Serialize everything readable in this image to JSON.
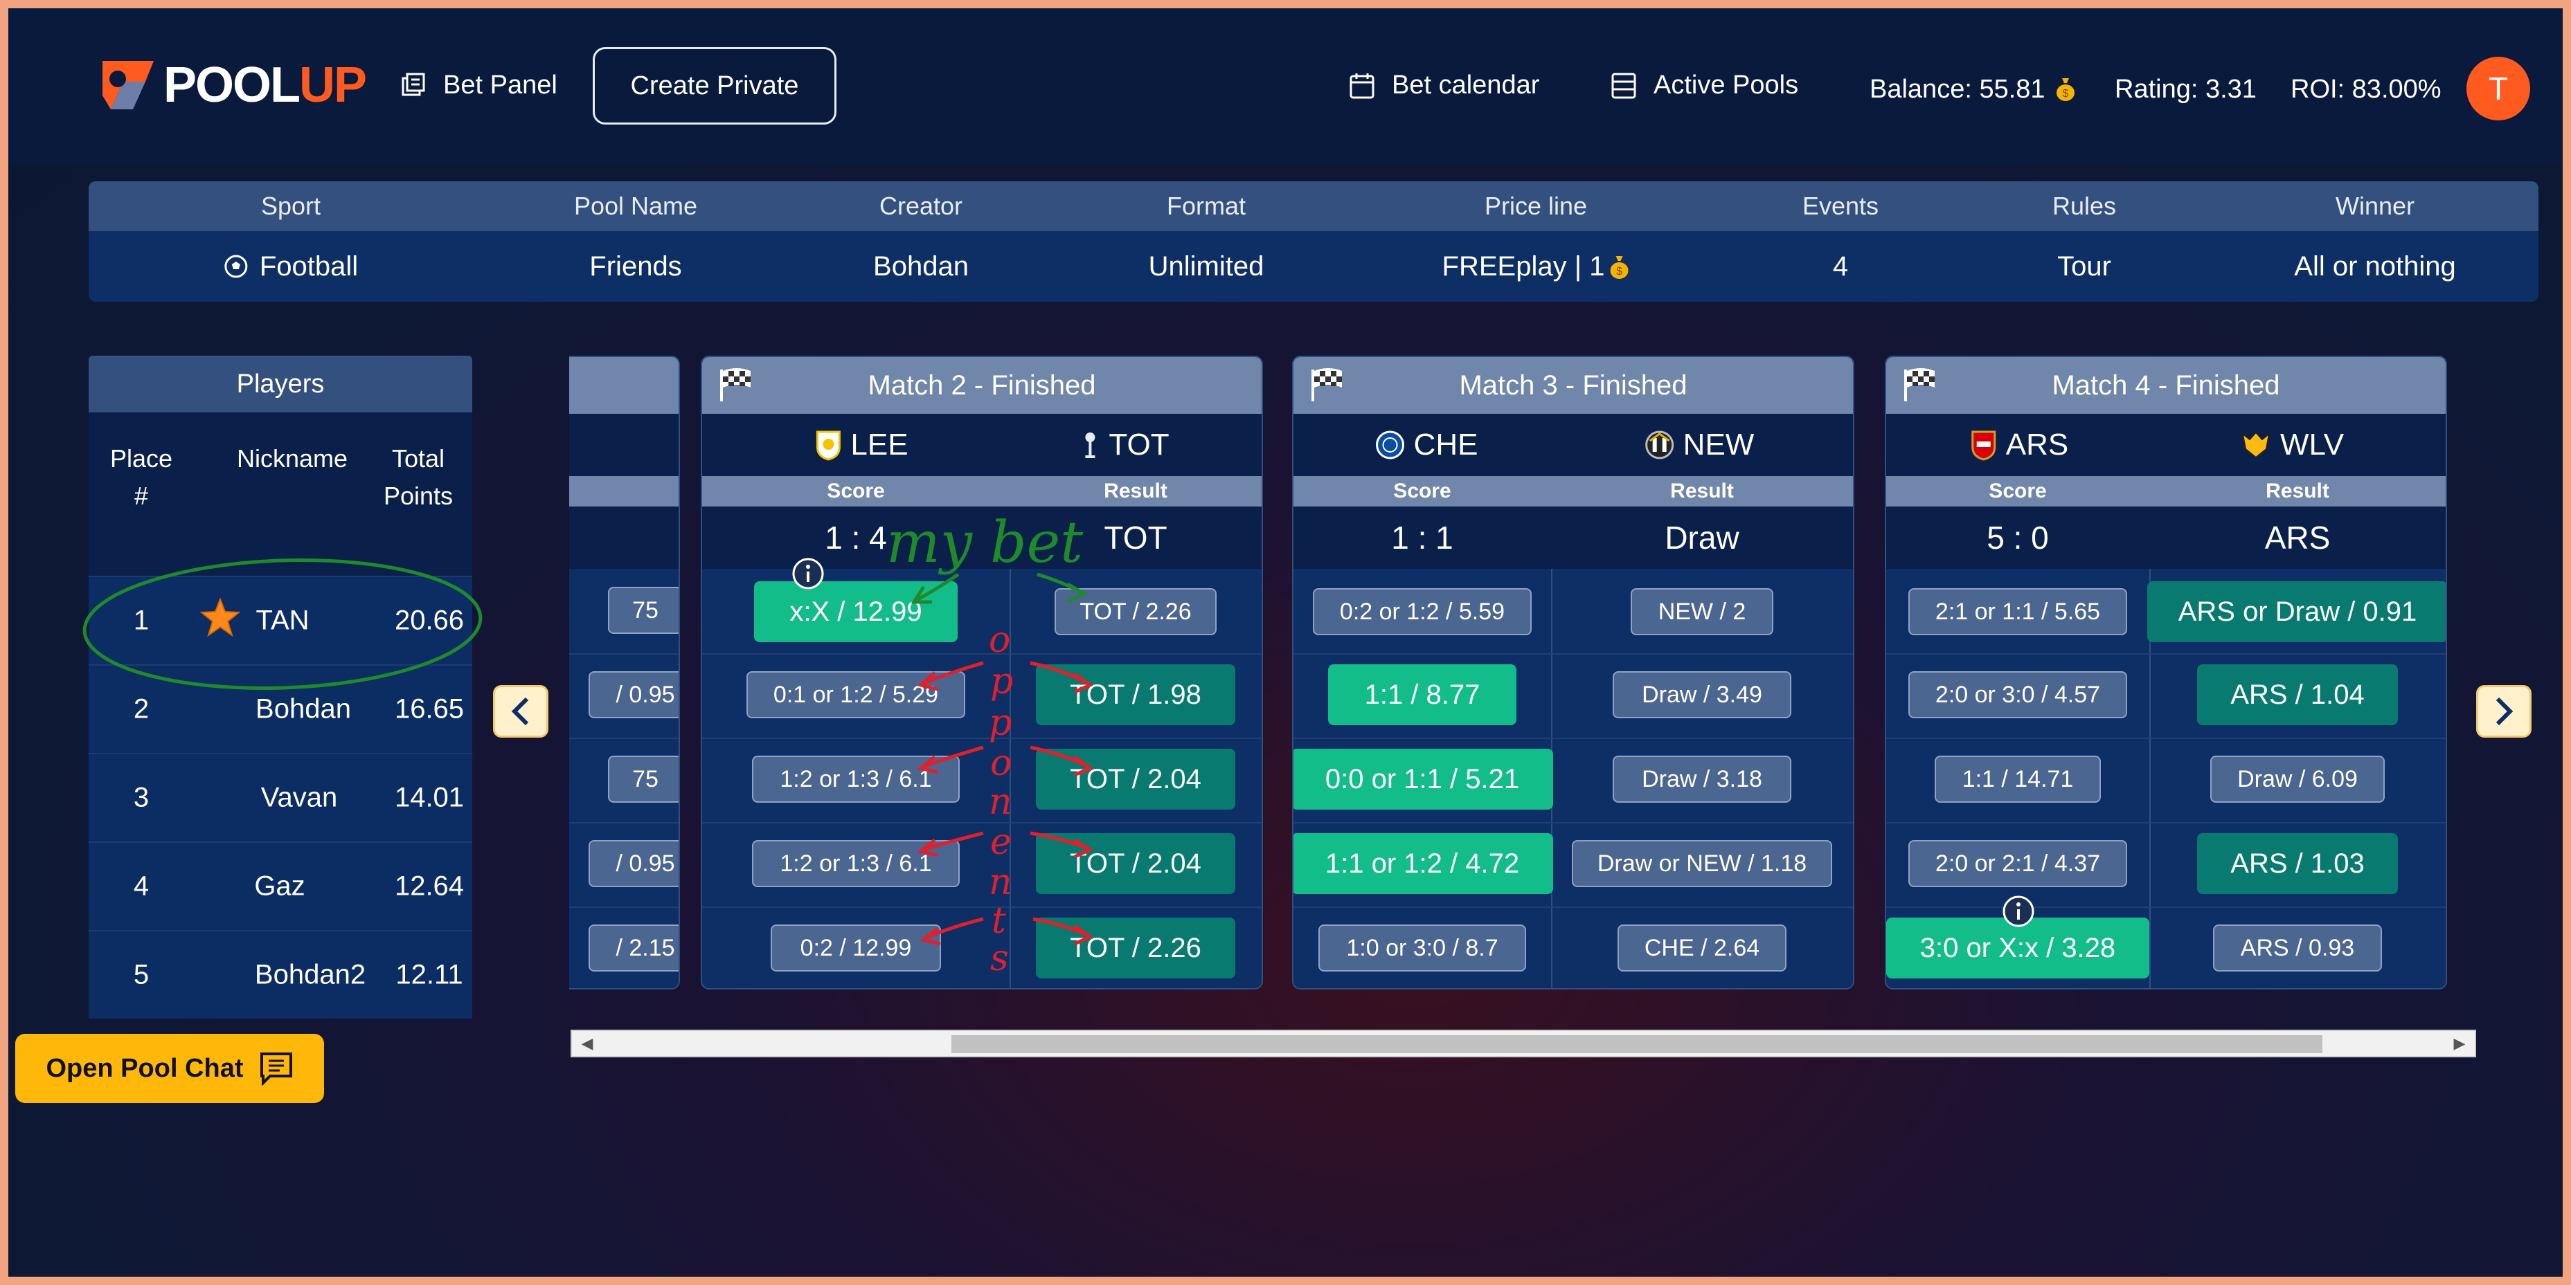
{
  "header": {
    "logo_pool": "POOL",
    "logo_up": "UP",
    "bet_panel": "Bet Panel",
    "create_private": "Create Private",
    "bet_calendar": "Bet calendar",
    "active_pools": "Active Pools",
    "balance": "Balance: 55.81",
    "rating": "Rating: 3.31",
    "roi": "ROI: 83.00%",
    "avatar_letter": "T"
  },
  "pool_info": {
    "headers": [
      "Sport",
      "Pool Name",
      "Creator",
      "Format",
      "Price line",
      "Events",
      "Rules",
      "Winner"
    ],
    "values": [
      "Football",
      "Friends",
      "Bohdan",
      "Unlimited",
      "FREEplay | 1",
      "4",
      "Tour",
      "All or nothing"
    ]
  },
  "players": {
    "title": "Players",
    "col_place_1": "Place",
    "col_place_2": "#",
    "col_nickname": "Nickname",
    "col_total_1": "Total",
    "col_total_2": "Points",
    "rows": [
      {
        "place": "1",
        "nickname": "TAN",
        "points": "20.66"
      },
      {
        "place": "2",
        "nickname": "Bohdan",
        "points": "16.65"
      },
      {
        "place": "3",
        "nickname": "Vavan",
        "points": "14.01"
      },
      {
        "place": "4",
        "nickname": "Gaz",
        "points": "12.64"
      },
      {
        "place": "5",
        "nickname": "Bohdan2",
        "points": "12.11"
      }
    ]
  },
  "match1_partial": {
    "bets": [
      "75",
      "/ 0.95",
      "75",
      "/ 0.95",
      "/ 2.15"
    ]
  },
  "matches": [
    {
      "title": "Match 2 - Finished",
      "home": "LEE",
      "away": "TOT",
      "score_label": "Score",
      "result_label": "Result",
      "score": "1 : 4",
      "result": "TOT",
      "score_bets": [
        "x:X / 12.99",
        "0:1 or 1:2 / 5.29",
        "1:2 or 1:3 / 6.1",
        "1:2 or 1:3 / 6.1",
        "0:2 / 12.99"
      ],
      "result_bets": [
        "TOT / 2.26",
        "TOT / 1.98",
        "TOT / 2.04",
        "TOT / 2.04",
        "TOT / 2.26"
      ]
    },
    {
      "title": "Match 3 - Finished",
      "home": "CHE",
      "away": "NEW",
      "score_label": "Score",
      "result_label": "Result",
      "score": "1 : 1",
      "result": "Draw",
      "score_bets": [
        "0:2 or 1:2 / 5.59",
        "1:1 / 8.77",
        "0:0 or 1:1 / 5.21",
        "1:1 or 1:2 / 4.72",
        "1:0 or 3:0 / 8.7"
      ],
      "result_bets": [
        "NEW / 2",
        "Draw / 3.49",
        "Draw / 3.18",
        "Draw or NEW / 1.18",
        "CHE / 2.64"
      ]
    },
    {
      "title": "Match 4 - Finished",
      "home": "ARS",
      "away": "WLV",
      "score_label": "Score",
      "result_label": "Result",
      "score": "5 : 0",
      "result": "ARS",
      "score_bets": [
        "2:1 or 1:1 / 5.65",
        "2:0 or 3:0 / 4.57",
        "1:1 / 14.71",
        "2:0 or 2:1 / 4.37",
        "3:0 or X:x / 3.28"
      ],
      "result_bets": [
        "ARS or Draw / 0.91",
        "ARS / 1.04",
        "Draw / 6.09",
        "ARS / 1.03",
        "ARS / 0.93"
      ]
    }
  ],
  "annotations": {
    "my_bet": "my bet",
    "opponents": [
      "o",
      "p",
      "p",
      "o",
      "n",
      "e",
      "n",
      "t",
      "s"
    ]
  },
  "chat": {
    "label": "Open Pool Chat"
  },
  "colors": {
    "accent_orange": "#ff5a1f",
    "win_green": "#13bd8a",
    "teal": "#097a70",
    "chat_yellow": "#ffb80a",
    "annotation_green": "#1f8a2a",
    "annotation_red": "#e0202a"
  }
}
